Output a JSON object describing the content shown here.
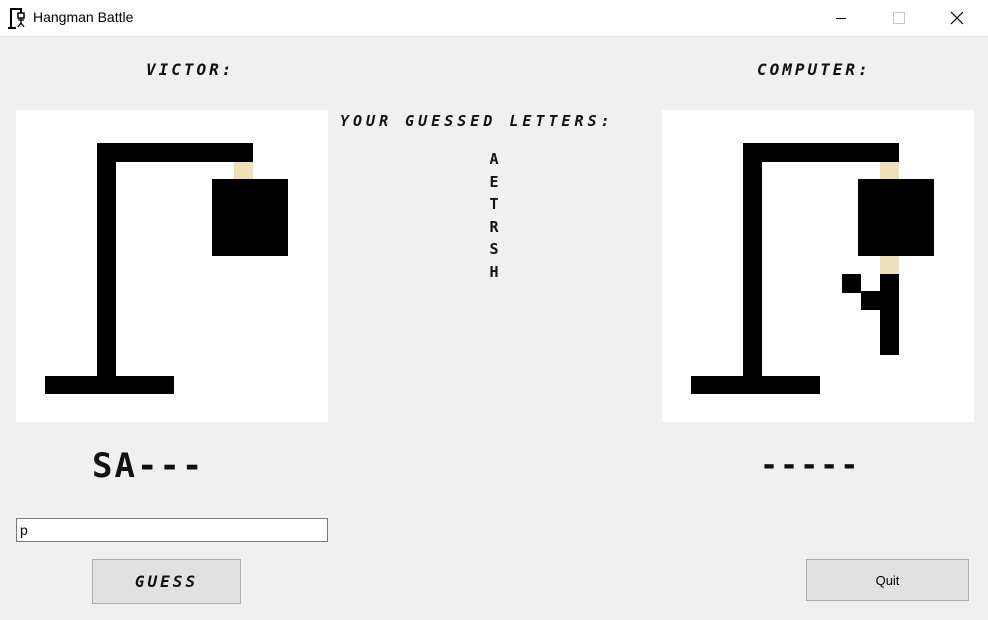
{
  "window": {
    "title": "Hangman Battle",
    "icon": "hangman-app-icon",
    "controls": [
      "minimize-icon",
      "maximize-icon",
      "close-icon"
    ]
  },
  "player": {
    "name": "VICTOR:",
    "word_progress": "SA---"
  },
  "computer": {
    "name": "COMPUTER:",
    "word_progress": "-----"
  },
  "guessed": {
    "title": "YOUR GUESSED LETTERS:",
    "letters": [
      "A",
      "E",
      "T",
      "R",
      "S",
      "H"
    ]
  },
  "guess_input": {
    "value": "p"
  },
  "buttons": {
    "guess_label": "GUESS",
    "quit_label": "Quit"
  },
  "colors": {
    "background": "#f0f0f0",
    "canvas": "#ffffff",
    "drawing": "#000000",
    "rope": "#eee0b8"
  }
}
